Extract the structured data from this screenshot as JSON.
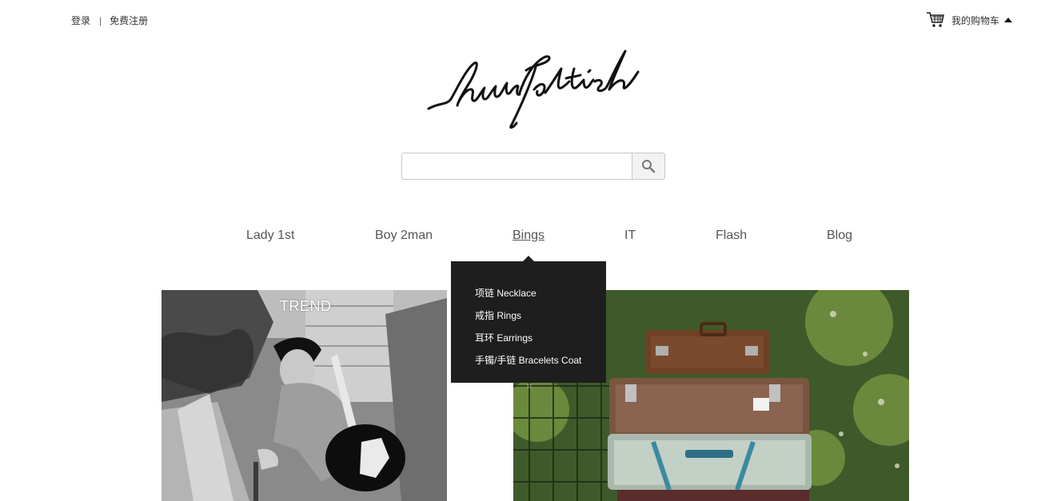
{
  "auth": {
    "login": "登录",
    "separator": "|",
    "register": "免费注册"
  },
  "cart": {
    "label": "我的购物车",
    "icon": "cart-icon"
  },
  "logo": {
    "text": "LuvFetish"
  },
  "search": {
    "placeholder": "",
    "value": "",
    "icon": "search-icon"
  },
  "nav": {
    "items": [
      {
        "label": "Lady 1st"
      },
      {
        "label": "Boy 2man"
      },
      {
        "label": "Bings"
      },
      {
        "label": "IT"
      },
      {
        "label": "Flash"
      },
      {
        "label": "Blog"
      }
    ],
    "active_index": 2
  },
  "dropdown": {
    "items": [
      {
        "label": "项链 Necklace"
      },
      {
        "label": "戒指 Rings"
      },
      {
        "label": "耳环 Earrings"
      },
      {
        "label": "手镯/手链 Bracelets Coat"
      }
    ]
  },
  "banners": {
    "left_caption": "TREND"
  },
  "colors": {
    "dropdown_bg": "#1e1e1e",
    "nav_text": "#555555",
    "text": "#333333"
  }
}
